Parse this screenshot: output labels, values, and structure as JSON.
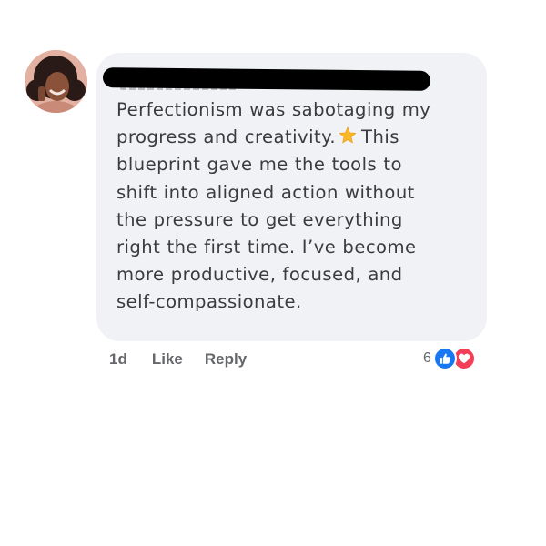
{
  "comment": {
    "author_redacted": true,
    "text_lines": [
      "Perfectionism was sabotaging my",
      "progress and creativity.",
      "This",
      "blueprint gave me the tools to",
      "shift into aligned action without",
      "the pressure to get everything",
      "right the first time. I’ve become",
      "more productive, focused, and",
      "self-compassionate."
    ],
    "emoji_icon": "star-emoji"
  },
  "actions": {
    "time": "1d",
    "like_label": "Like",
    "reply_label": "Reply"
  },
  "reactions": {
    "count": "6",
    "icons": [
      "like-thumb-icon",
      "love-heart-icon"
    ]
  },
  "colors": {
    "bubble_bg": "#f0f2f5",
    "text": "#3a3b3c",
    "meta_text": "#65676b",
    "like_blue": "#1877f2",
    "love_red": "#f33e58",
    "star": "#f7b928"
  }
}
